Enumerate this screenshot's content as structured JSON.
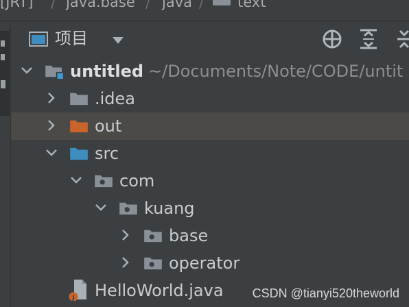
{
  "breadcrumb": {
    "items": [
      "[JRT]",
      "java.base",
      "java",
      "text"
    ],
    "separator": "/"
  },
  "panel": {
    "title": "项目",
    "dropdown_icon": "caret-down-icon",
    "actions": [
      "locate-icon",
      "expand-all-icon",
      "collapse-all-icon"
    ]
  },
  "tree": {
    "root": {
      "name": "untitled",
      "path": "~/Documents/Note/CODE/untit"
    },
    "nodes": [
      {
        "label": ".idea",
        "kind": "folder",
        "expanded": false
      },
      {
        "label": "out",
        "kind": "excluded-folder",
        "expanded": false,
        "selected": true
      },
      {
        "label": "src",
        "kind": "source-folder",
        "expanded": true
      },
      {
        "label": "com",
        "kind": "package",
        "expanded": true
      },
      {
        "label": "kuang",
        "kind": "package",
        "expanded": true
      },
      {
        "label": "base",
        "kind": "package",
        "expanded": false
      },
      {
        "label": "operator",
        "kind": "package",
        "expanded": false
      },
      {
        "label": "HelloWorld.java",
        "kind": "java-file"
      }
    ]
  },
  "watermark": "CSDN @tianyi520theworld",
  "colors": {
    "background": "#3c3f41",
    "selection": "#4b4a47",
    "folder": "#8a9097",
    "excluded_folder": "#c9642a",
    "source_folder": "#3d8dbe",
    "text": "#c9ccce"
  }
}
